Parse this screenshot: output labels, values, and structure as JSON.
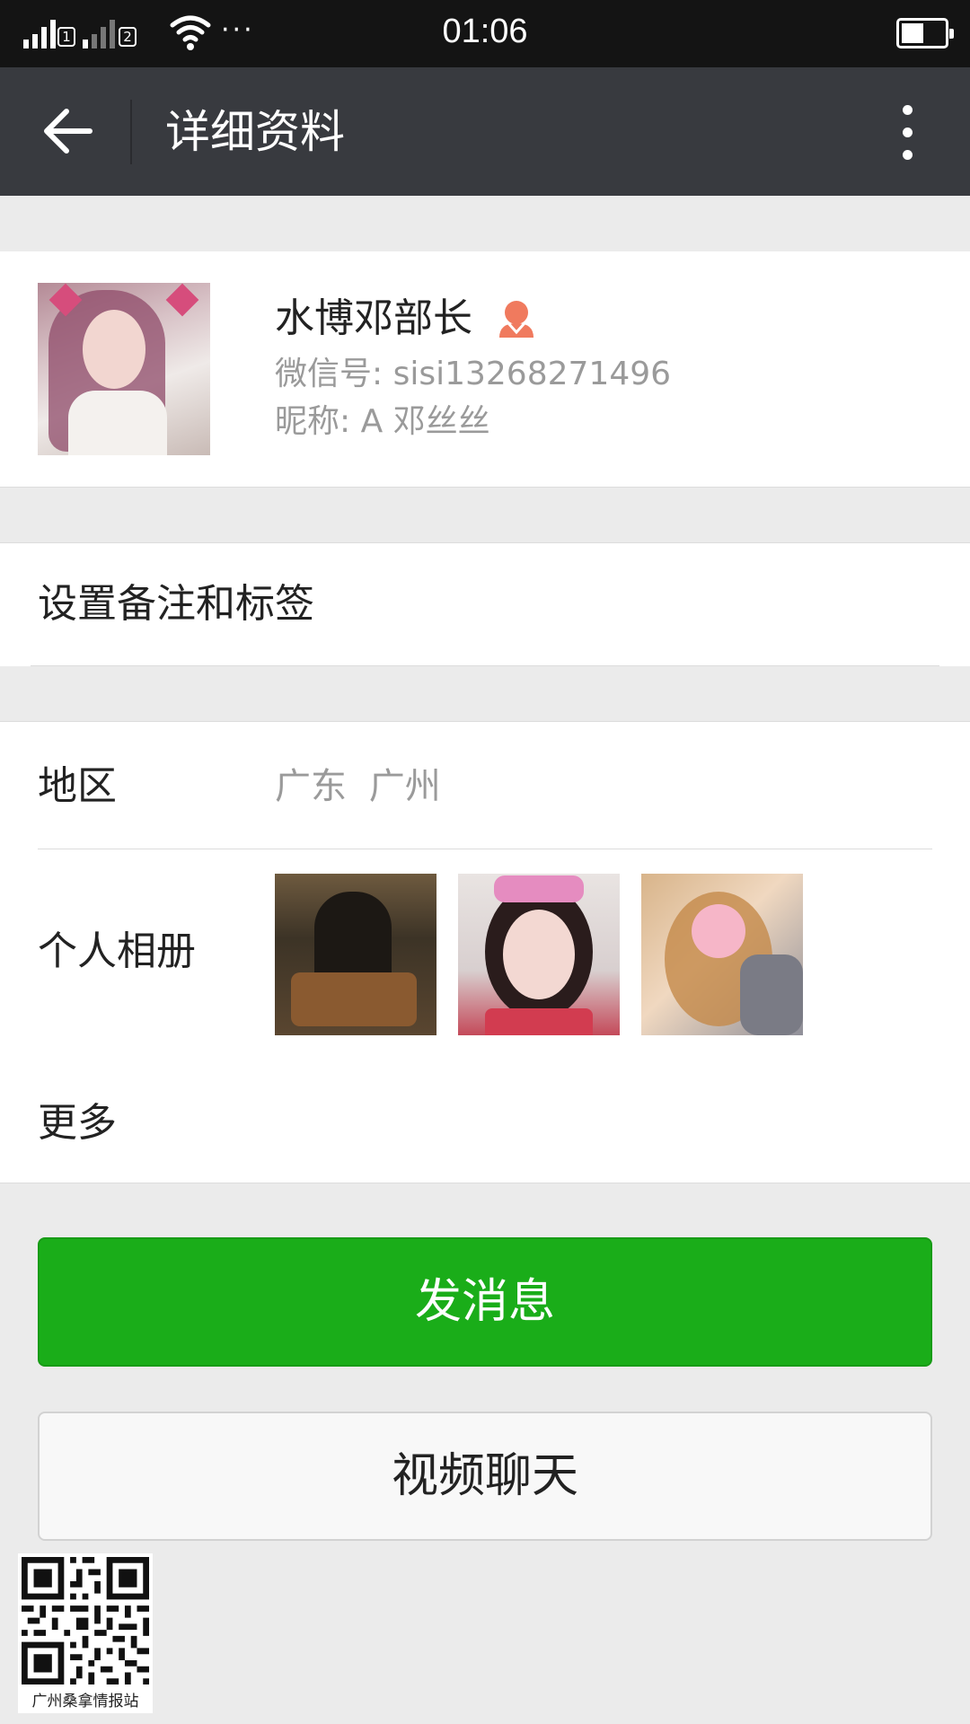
{
  "status_bar": {
    "time": "01:06",
    "sim1": "1",
    "sim2": "2",
    "overflow": "···",
    "icons": [
      "signal-icon",
      "wifi-icon",
      "battery-icon"
    ]
  },
  "navbar": {
    "title": "详细资料",
    "back_icon": "back-arrow-icon",
    "menu_icon": "more-vertical-icon"
  },
  "profile": {
    "name": "水博邓部长",
    "gender_icon": "female-icon",
    "wechat_id": "微信号: sisi13268271496",
    "nickname": "昵称: A 邓丝丝"
  },
  "remark": {
    "label": "设置备注和标签"
  },
  "info": {
    "region_label": "地区",
    "region_value": "广东  广州",
    "album_label": "个人相册",
    "album_count_shown": 3,
    "more_label": "更多"
  },
  "buttons": {
    "send_message": "发消息",
    "video_chat": "视频聊天"
  },
  "qr_code": {
    "caption": "广州桑拿情报站"
  },
  "colors": {
    "accent_green": "#1aad19",
    "navbar_bg": "#383a3f",
    "status_bg": "#141414",
    "page_bg": "#ebebeb",
    "female_icon": "#f07a5e"
  }
}
